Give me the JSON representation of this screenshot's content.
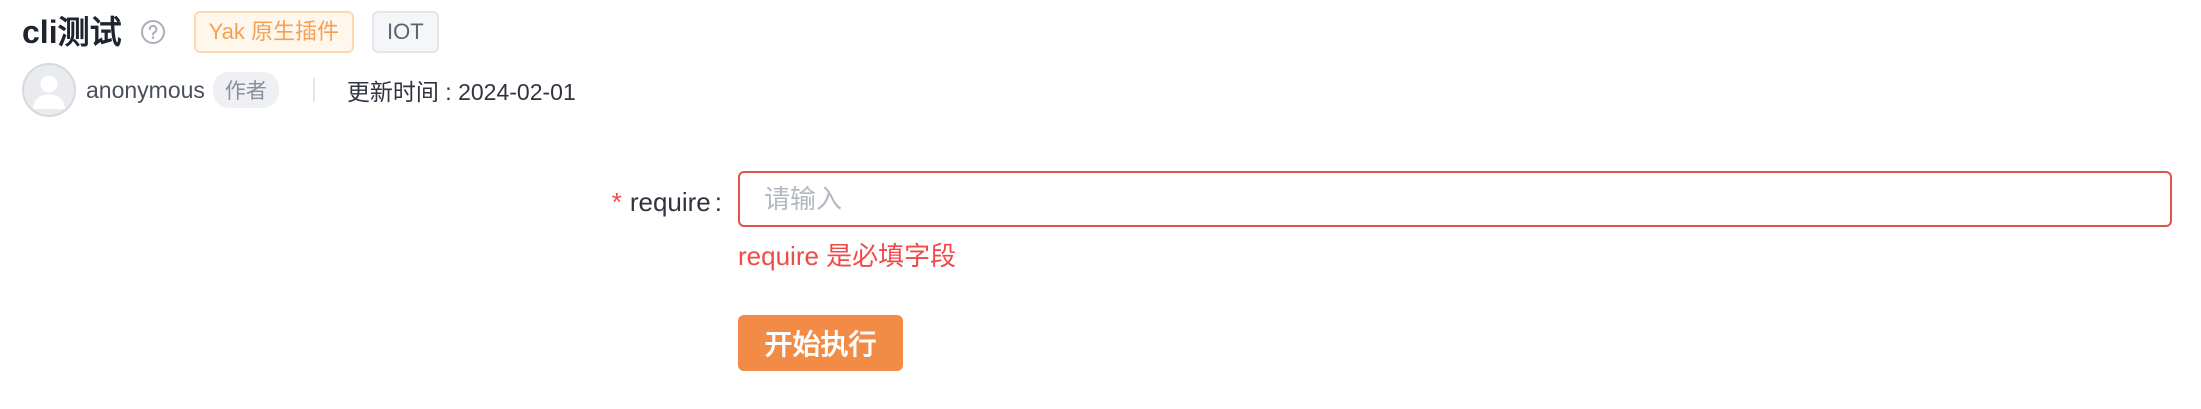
{
  "plugin": {
    "title": "cli测试",
    "help_icon": "question-circle-icon",
    "tags": [
      {
        "label": "Yak 原生插件",
        "color": "#f5a154"
      },
      {
        "label": "IOT",
        "color": "#5d6373"
      }
    ]
  },
  "author": {
    "avatar_icon": "user-avatar-icon",
    "name": "anonymous",
    "badge": "作者"
  },
  "update": {
    "label": "更新时间 : ",
    "date": "2024-02-01"
  },
  "form": {
    "required_mark": "*",
    "field_label": "require",
    "field_colon": ":",
    "placeholder": "请输入",
    "value": "",
    "error": "require 是必填字段",
    "error_color": "#f04a48"
  },
  "actions": {
    "run_label": "开始执行",
    "run_color": "#f28b45"
  }
}
